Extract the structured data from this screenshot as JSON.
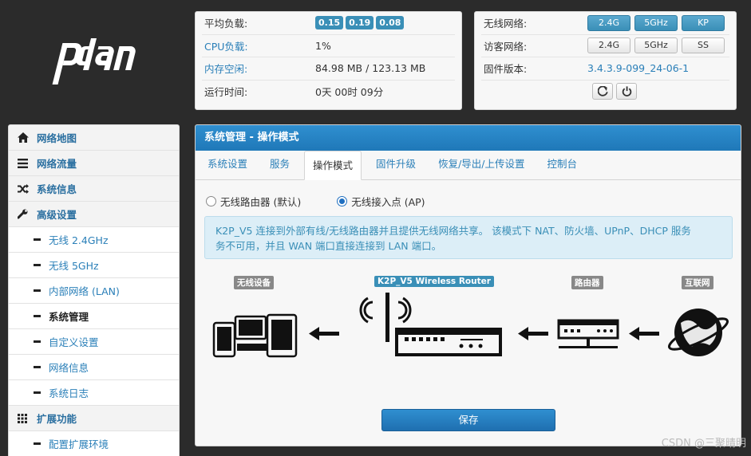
{
  "status": {
    "avg_load_label": "平均负载:",
    "avg_load": [
      "0.15",
      "0.19",
      "0.08"
    ],
    "cpu_label": "CPU负载:",
    "cpu_value": "1%",
    "mem_label": "内存空闲:",
    "mem_value": "84.98 MB / 123.13 MB",
    "uptime_label": "运行时间:",
    "uptime_value": "0天 00时 09分"
  },
  "wireless": {
    "wifi_label": "无线网络:",
    "wifi_buttons": [
      "2.4G",
      "5GHz",
      "KP"
    ],
    "guest_label": "访客网络:",
    "guest_buttons": [
      "2.4G",
      "5GHz",
      "SS"
    ],
    "fw_label": "固件版本:",
    "fw_value": "3.4.3.9-099_24-06-1",
    "icons": [
      "refresh-icon",
      "power-icon"
    ],
    "accent": "#3a8fb7"
  },
  "sidebar": {
    "items": [
      {
        "label": "网络地图",
        "icon": "home-icon"
      },
      {
        "label": "网络流量",
        "icon": "list-icon"
      },
      {
        "label": "系统信息",
        "icon": "shuffle-icon"
      },
      {
        "label": "高级设置",
        "icon": "wrench-icon"
      },
      {
        "label": "无线 2.4GHz"
      },
      {
        "label": "无线 5GHz"
      },
      {
        "label": "内部网络 (LAN)"
      },
      {
        "label": "系统管理"
      },
      {
        "label": "自定义设置"
      },
      {
        "label": "网络信息"
      },
      {
        "label": "系统日志"
      },
      {
        "label": "扩展功能",
        "icon": "grid-icon"
      },
      {
        "label": "配置扩展环境"
      }
    ]
  },
  "main": {
    "title": "系统管理 - 操作模式",
    "tabs": [
      "系统设置",
      "服务",
      "操作模式",
      "固件升级",
      "恢复/导出/上传设置",
      "控制台"
    ],
    "radio_router": "无线路由器 (默认)",
    "radio_ap": "无线接入点 (AP)",
    "info_line1": "K2P_V5 连接到外部有线/无线路由器并且提供无线网络共享。 该模式下 NAT、防火墙、UPnP、DHCP 服务",
    "info_line2": "务不可用，并且 WAN 端口直接连接到 LAN 端口。",
    "diagram": {
      "devices": "无线设备",
      "router_ap": "K2P_V5 Wireless Router",
      "router": "路由器",
      "internet": "互联网"
    },
    "save": "保存"
  },
  "watermark": "CSDN @三聚晴明"
}
